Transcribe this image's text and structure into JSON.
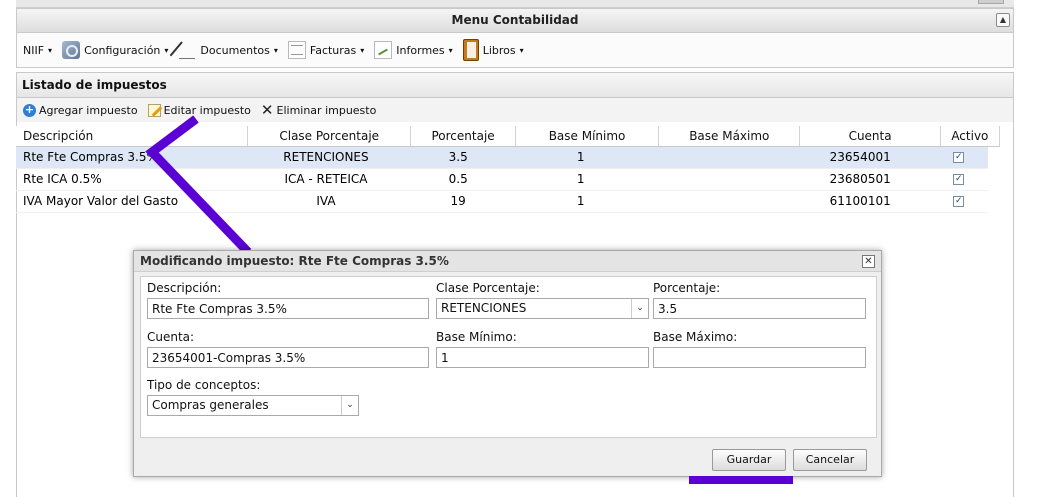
{
  "menu": {
    "title": "Menu Contabilidad",
    "items": [
      {
        "label": "NIIF",
        "icon": "none"
      },
      {
        "label": "Configuración",
        "icon": "settings-icon"
      },
      {
        "label": "Documentos",
        "icon": "pencil-icon"
      },
      {
        "label": "Facturas",
        "icon": "invoice-icon"
      },
      {
        "label": "Informes",
        "icon": "report-icon"
      },
      {
        "label": "Libros",
        "icon": "book-icon"
      }
    ],
    "collapse_glyph": "▲"
  },
  "panel": {
    "title": "Listado de impuestos",
    "toolbar": {
      "add_label": "Agregar impuesto",
      "edit_label": "Editar impuesto",
      "delete_label": "Eliminar impuesto"
    }
  },
  "grid": {
    "columns": [
      "Descripción",
      "Clase Porcentaje",
      "Porcentaje",
      "Base Mínimo",
      "Base Máximo",
      "Cuenta",
      "Activo"
    ],
    "rows": [
      {
        "descripcion": "Rte Fte Compras 3.5%",
        "clase": "RETENCIONES",
        "porcentaje": "3.5",
        "base_min": "1",
        "base_max": "",
        "cuenta": "23654001",
        "activo": "✓"
      },
      {
        "descripcion": "Rte ICA 0.5%",
        "clase": "ICA - RETEICA",
        "porcentaje": "0.5",
        "base_min": "1",
        "base_max": "",
        "cuenta": "23680501",
        "activo": "✓"
      },
      {
        "descripcion": "IVA Mayor Valor del Gasto",
        "clase": "IVA",
        "porcentaje": "19",
        "base_min": "1",
        "base_max": "",
        "cuenta": "61100101",
        "activo": "✓"
      }
    ]
  },
  "dialog": {
    "title": "Modificando impuesto: Rte Fte Compras 3.5%",
    "close_glyph": "✕",
    "fields": {
      "descripcion": {
        "label": "Descripción:",
        "value": "Rte Fte Compras 3.5%"
      },
      "clase": {
        "label": "Clase Porcentaje:",
        "value": "RETENCIONES"
      },
      "porcentaje": {
        "label": "Porcentaje:",
        "value": "3.5"
      },
      "cuenta": {
        "label": "Cuenta:",
        "value": "23654001-Compras 3.5%"
      },
      "base_min": {
        "label": "Base Mínimo:",
        "value": "1"
      },
      "base_max": {
        "label": "Base Máximo:",
        "value": ""
      },
      "tipo": {
        "label": "Tipo de conceptos:",
        "value": "Compras generales"
      }
    },
    "save_label": "Guardar",
    "cancel_label": "Cancelar"
  },
  "colors": {
    "annotation": "#5a00d4",
    "selected_row": "#dde7f5",
    "add_icon": "#2f7fd2"
  },
  "dropdown_glyph": "▾",
  "select_glyph": "⌄"
}
